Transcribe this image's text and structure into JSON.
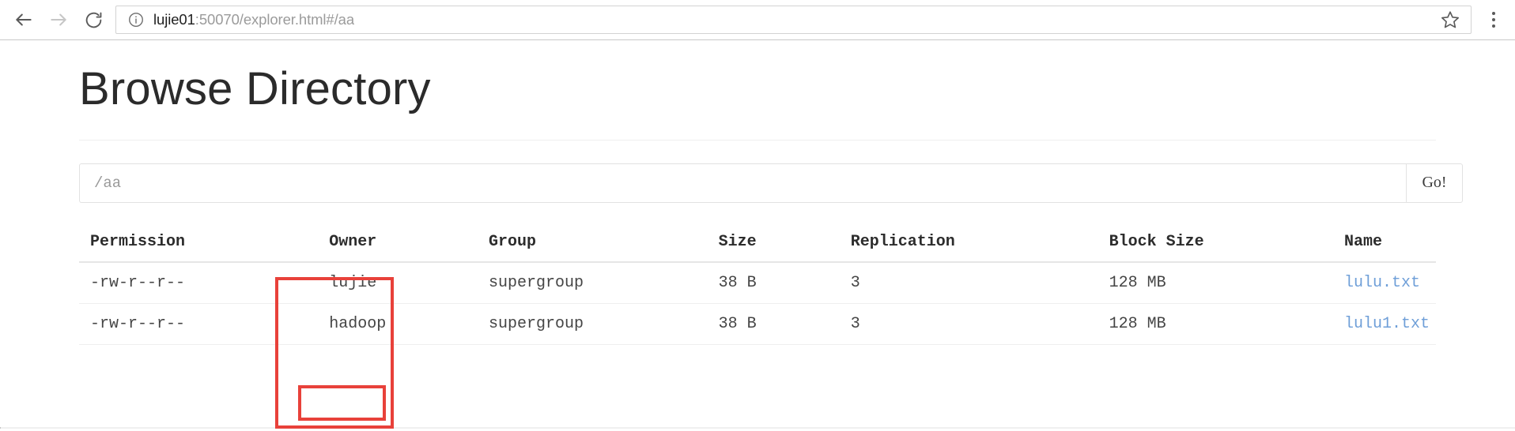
{
  "browser": {
    "back_icon": "back-arrow-icon",
    "forward_icon": "forward-arrow-icon",
    "reload_icon": "reload-icon",
    "info_icon": "info-circle-icon",
    "star_icon": "bookmark-star-icon",
    "menu_icon": "three-dot-menu-icon",
    "url_host": "lujie01",
    "url_rest": ":50070/explorer.html#/aa"
  },
  "page": {
    "title": "Browse Directory"
  },
  "search": {
    "value": "/aa",
    "placeholder": "/aa",
    "go_label": "Go!"
  },
  "table": {
    "headers": {
      "permission": "Permission",
      "owner": "Owner",
      "group": "Group",
      "size": "Size",
      "replication": "Replication",
      "block_size": "Block Size",
      "name": "Name"
    },
    "rows": [
      {
        "permission": "-rw-r--r--",
        "owner": "lujie",
        "group": "supergroup",
        "size": "38 B",
        "replication": "3",
        "block_size": "128 MB",
        "name": "lulu.txt"
      },
      {
        "permission": "-rw-r--r--",
        "owner": "hadoop",
        "group": "supergroup",
        "size": "38 B",
        "replication": "3",
        "block_size": "128 MB",
        "name": "lulu1.txt"
      }
    ]
  },
  "annotations": {
    "color": "#e8413a",
    "outer_target": "owner-column",
    "inner_target": "owner-hadoop-cell"
  }
}
